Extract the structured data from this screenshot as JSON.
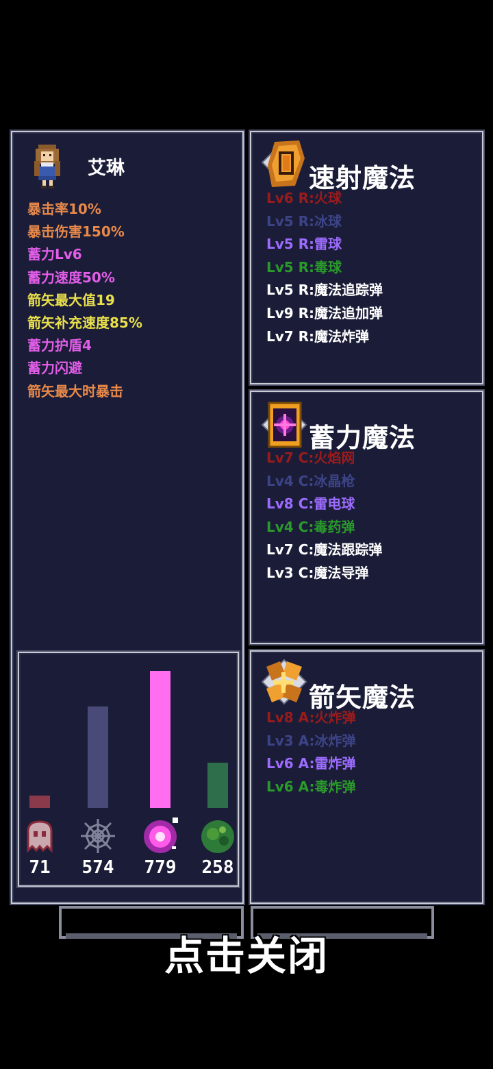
{
  "character": {
    "name": "艾琳",
    "attributes": [
      {
        "text": "暴击率10%",
        "color": "#e8894a"
      },
      {
        "text": "暴击伤害150%",
        "color": "#e8894a"
      },
      {
        "text": "蓄力Lv6",
        "color": "#e25ee8"
      },
      {
        "text": "蓄力速度50%",
        "color": "#e25ee8"
      },
      {
        "text": "箭矢最大值19",
        "color": "#e9e04b"
      },
      {
        "text": "箭矢补充速度85%",
        "color": "#e9e04b"
      },
      {
        "text": "蓄力护盾4",
        "color": "#e25ee8"
      },
      {
        "text": "蓄力闪避",
        "color": "#e25ee8"
      },
      {
        "text": "箭矢最大时暴击",
        "color": "#e8894a"
      }
    ]
  },
  "resources": [
    {
      "icon": "fire-ghost-icon",
      "value": "71",
      "bar_color": "#8a3a4a",
      "level": 0.09
    },
    {
      "icon": "ice-web-icon",
      "value": "574",
      "bar_color": "#4a4a78",
      "level": 0.74
    },
    {
      "icon": "thunder-orb-icon",
      "value": "779",
      "bar_color": "#ff6ef0",
      "level": 1.0
    },
    {
      "icon": "poison-slime-icon",
      "value": "258",
      "bar_color": "#2e6e4a",
      "level": 0.33
    }
  ],
  "magic_panels": [
    {
      "title": "速射魔法",
      "icon": "rapid-magic-icon",
      "spells": [
        {
          "text": "Lv6 R:火球",
          "color": "#9a1b1b"
        },
        {
          "text": "Lv5 R:冰球",
          "color": "#3c4488"
        },
        {
          "text": "Lv5 R:雷球",
          "color": "#9d6cff"
        },
        {
          "text": "Lv5 R:毒球",
          "color": "#2a9a2a"
        },
        {
          "text": "Lv5 R:魔法追踪弹",
          "color": "#ffffff"
        },
        {
          "text": "Lv9 R:魔法追加弹",
          "color": "#ffffff"
        },
        {
          "text": "Lv7 R:魔法炸弹",
          "color": "#ffffff"
        }
      ]
    },
    {
      "title": "蓄力魔法",
      "icon": "charge-magic-icon",
      "spells": [
        {
          "text": "Lv7 C:火焰网",
          "color": "#9a1b1b"
        },
        {
          "text": "Lv4 C:冰晶枪",
          "color": "#3c4488"
        },
        {
          "text": "Lv8 C:雷电球",
          "color": "#9d6cff"
        },
        {
          "text": "Lv4 C:毒药弹",
          "color": "#2a9a2a"
        },
        {
          "text": "Lv7 C:魔法跟踪弹",
          "color": "#ffffff"
        },
        {
          "text": "Lv3 C:魔法导弹",
          "color": "#ffffff"
        }
      ]
    },
    {
      "title": "箭矢魔法",
      "icon": "arrow-magic-icon",
      "spells": [
        {
          "text": "Lv8 A:火炸弹",
          "color": "#9a1b1b"
        },
        {
          "text": "Lv3 A:冰炸弹",
          "color": "#3c4488"
        },
        {
          "text": "Lv6 A:雷炸弹",
          "color": "#9d6cff"
        },
        {
          "text": "Lv6 A:毒炸弹",
          "color": "#2a9a2a"
        }
      ]
    }
  ],
  "close_hint": "点击关闭"
}
